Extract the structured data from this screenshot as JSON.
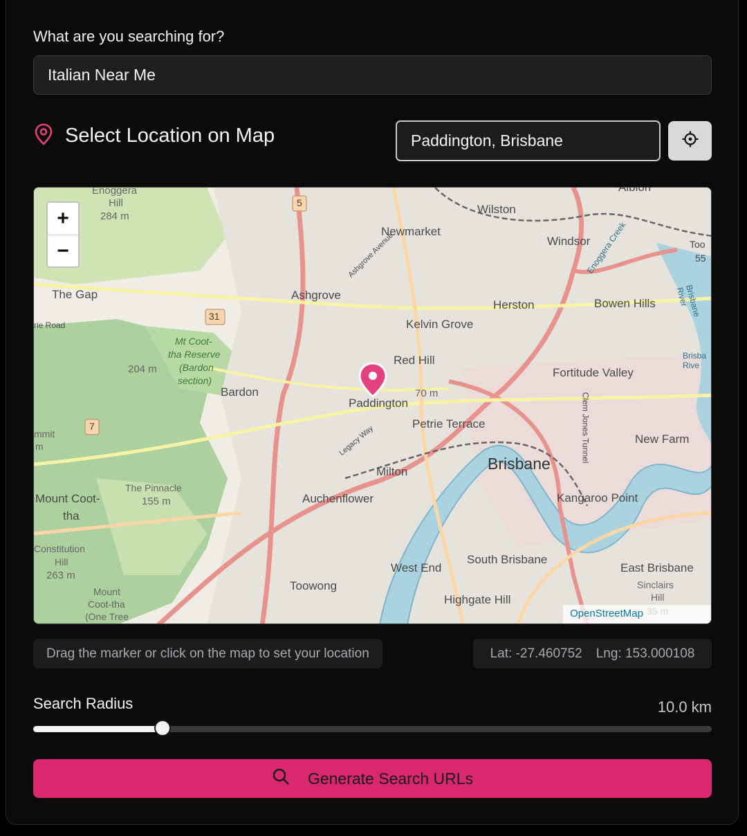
{
  "search": {
    "label": "What are you searching for?",
    "value": "Italian Near Me"
  },
  "location": {
    "title": "Select Location on Map",
    "title_icon": "map-pin-icon",
    "input_value": "Paddington, Brisbane",
    "locate_icon": "crosshair-icon",
    "accent_color": "#e5417f"
  },
  "map": {
    "zoom_in": "+",
    "zoom_out": "−",
    "attribution": "OpenStreetMap",
    "labels": {
      "enoggera": "Enoggera",
      "hill": "Hill",
      "alt284": "284 m",
      "wilston": "Wilston",
      "newmarket": "Newmarket",
      "windsor": "Windsor",
      "thegap": "The Gap",
      "ashgrove": "Ashgrove",
      "herston": "Herston",
      "bowenhills": "Bowen Hills",
      "kelvingrove": "Kelvin Grove",
      "mtcoottha_reserve1": "Mt Coot-",
      "mtcoottha_reserve2": "tha Reserve",
      "mtcoottha_reserve3": "(Bardon",
      "mtcoottha_reserve4": "section)",
      "alt204": "204 m",
      "redhill": "Red Hill",
      "fortitude": "Fortitude Valley",
      "bardon": "Bardon",
      "paddington": "Paddington",
      "alt70": "70 m",
      "petrie": "Petrie Terrace",
      "newfarm": "New Farm",
      "brisbane": "Brisbane",
      "milton": "Milton",
      "pinnacle": "The Pinnacle",
      "alt155": "155 m",
      "mtcoottha1": "Mount Coot-",
      "mtcoottha2": "tha",
      "auchenflower": "Auchenflower",
      "kangaroo": "Kangaroo Point",
      "constitution1": "Constitution",
      "constitution2": "Hill",
      "alt263": "263 m",
      "westend": "West End",
      "southbrisbane": "South Brisbane",
      "eastbrisbane": "East Brisbane",
      "toowong": "Toowong",
      "highgate": "Highgate Hill",
      "mount2": "Mount",
      "mount3": "Coot-tha",
      "mount4": "(One Tree",
      "road5": "5",
      "road31": "31",
      "road7": "7",
      "sinclairs": "Sinclairs",
      "sinclairs2": "Hill",
      "ashgroveave": "Ashgrove Avenue",
      "legacyway": "Legacy Way",
      "enoggeracreek": "Enoggera Creek",
      "brisbaneriver": "Brisbane River",
      "clemjones": "Clem Jones Tunnel",
      "albion": "Albion",
      "road": "rie Road",
      "summit1": "mmit",
      "summit2": "m",
      "brisbane_rive": "Brisba Rive",
      "too": "Too",
      "r55": "55",
      "alt35": "35 m"
    }
  },
  "hint": "Drag the marker or click on the map to set your location",
  "coords": {
    "lat": "Lat: -27.460752",
    "lng": "Lng: 153.000108"
  },
  "radius": {
    "label": "Search Radius",
    "value_text": "10.0 km",
    "fraction": 0.191
  },
  "generate": {
    "label": "Generate Search URLs",
    "icon": "search-icon",
    "color": "#d9286f"
  }
}
